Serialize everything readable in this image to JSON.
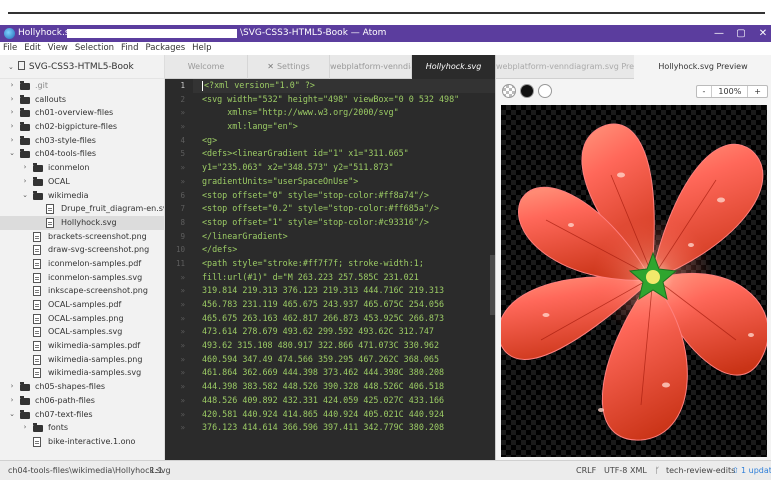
{
  "window": {
    "title_prefix": "Hollyhock.svg —",
    "title_suffix": "\\SVG-CSS3-HTML5-Book — Atom",
    "controls": [
      "—",
      "▢",
      "✕"
    ]
  },
  "menu": [
    "File",
    "Edit",
    "View",
    "Selection",
    "Find",
    "Packages",
    "Help"
  ],
  "tree": {
    "root": "SVG-CSS3-HTML5-Book",
    "items": [
      {
        "label": ".git",
        "type": "folder",
        "level": 1,
        "open": false,
        "muted": true
      },
      {
        "label": "callouts",
        "type": "folder",
        "level": 1,
        "open": false
      },
      {
        "label": "ch01-overview-files",
        "type": "folder",
        "level": 1,
        "open": false
      },
      {
        "label": "ch02-bigpicture-files",
        "type": "folder",
        "level": 1,
        "open": false
      },
      {
        "label": "ch03-style-files",
        "type": "folder",
        "level": 1,
        "open": false
      },
      {
        "label": "ch04-tools-files",
        "type": "folder",
        "level": 1,
        "open": true
      },
      {
        "label": "iconmelon",
        "type": "folder",
        "level": 2,
        "open": false
      },
      {
        "label": "OCAL",
        "type": "folder",
        "level": 2,
        "open": false
      },
      {
        "label": "wikimedia",
        "type": "folder",
        "level": 2,
        "open": true
      },
      {
        "label": "Drupe_fruit_diagram-en.svg",
        "type": "file",
        "level": 3
      },
      {
        "label": "Hollyhock.svg",
        "type": "file",
        "level": 3,
        "selected": true
      },
      {
        "label": "brackets-screenshot.png",
        "type": "file",
        "level": 2
      },
      {
        "label": "draw-svg-screenshot.png",
        "type": "file",
        "level": 2
      },
      {
        "label": "iconmelon-samples.pdf",
        "type": "file",
        "level": 2
      },
      {
        "label": "iconmelon-samples.svg",
        "type": "file",
        "level": 2
      },
      {
        "label": "inkscape-screenshot.png",
        "type": "file",
        "level": 2
      },
      {
        "label": "OCAL-samples.pdf",
        "type": "file",
        "level": 2
      },
      {
        "label": "OCAL-samples.png",
        "type": "file",
        "level": 2
      },
      {
        "label": "OCAL-samples.svg",
        "type": "file",
        "level": 2
      },
      {
        "label": "wikimedia-samples.pdf",
        "type": "file",
        "level": 2
      },
      {
        "label": "wikimedia-samples.png",
        "type": "file",
        "level": 2
      },
      {
        "label": "wikimedia-samples.svg",
        "type": "file",
        "level": 2
      },
      {
        "label": "ch05-shapes-files",
        "type": "folder",
        "level": 1,
        "open": false
      },
      {
        "label": "ch06-path-files",
        "type": "folder",
        "level": 1,
        "open": false
      },
      {
        "label": "ch07-text-files",
        "type": "folder",
        "level": 1,
        "open": true
      },
      {
        "label": "fonts",
        "type": "folder",
        "level": 2,
        "open": false
      },
      {
        "label": "bike-interactive.1.ono",
        "type": "file",
        "level": 2
      }
    ]
  },
  "editor_tabs": [
    {
      "label": "Welcome",
      "active": false
    },
    {
      "label": "Settings",
      "active": false,
      "icon": "wrench-icon"
    },
    {
      "label": "webplatform-venndia",
      "active": false
    },
    {
      "label": "Hollyhock.svg",
      "active": true
    }
  ],
  "code": {
    "current_line": 1,
    "lines": [
      {
        "n": "1",
        "text": "<?xml version=\"1.0\" ?>"
      },
      {
        "n": "2",
        "text": "<svg width=\"532\" height=\"498\" viewBox=\"0 0 532 498\""
      },
      {
        "n": "»",
        "text": "     xmlns=\"http://www.w3.org/2000/svg\""
      },
      {
        "n": "»",
        "text": "     xml:lang=\"en\">"
      },
      {
        "n": "4",
        "text": "<g>"
      },
      {
        "n": "5",
        "text": "<defs><linearGradient id=\"1\" x1=\"311.665\""
      },
      {
        "n": "»",
        "text": "y1=\"235.063\" x2=\"348.573\" y2=\"511.873\""
      },
      {
        "n": "»",
        "text": "gradientUnits=\"userSpaceOnUse\">"
      },
      {
        "n": "6",
        "text": "<stop offset=\"0\" style=\"stop-color:#ff8a74\"/>"
      },
      {
        "n": "7",
        "text": "<stop offset=\"0.2\" style=\"stop-color:#ff685a\"/>"
      },
      {
        "n": "8",
        "text": "<stop offset=\"1\" style=\"stop-color:#c93316\"/>"
      },
      {
        "n": "9",
        "text": "</linearGradient>"
      },
      {
        "n": "10",
        "text": "</defs>"
      },
      {
        "n": "11",
        "text": "<path style=\"stroke:#ff7f7f; stroke-width:1;"
      },
      {
        "n": "»",
        "text": "fill:url(#1)\" d=\"M 263.223 257.585C 231.021"
      },
      {
        "n": "»",
        "text": "319.814 219.313 376.123 219.313 444.716C 219.313"
      },
      {
        "n": "»",
        "text": "456.783 231.119 465.675 243.937 465.675C 254.056"
      },
      {
        "n": "»",
        "text": "465.675 263.163 462.817 266.873 453.925C 266.873"
      },
      {
        "n": "»",
        "text": "473.614 278.679 493.62 299.592 493.62C 312.747"
      },
      {
        "n": "»",
        "text": "493.62 315.108 480.917 322.866 471.073C 330.962"
      },
      {
        "n": "»",
        "text": "460.594 347.49 474.566 359.295 467.262C 368.065"
      },
      {
        "n": "»",
        "text": "461.864 362.669 444.398 373.462 444.398C 380.208"
      },
      {
        "n": "»",
        "text": "444.398 383.582 448.526 390.328 448.526C 406.518"
      },
      {
        "n": "»",
        "text": "448.526 409.892 432.331 424.059 425.027C 433.166"
      },
      {
        "n": "»",
        "text": "420.581 440.924 414.865 440.924 405.021C 440.924"
      },
      {
        "n": "»",
        "text": "376.123 414.614 366.596 397.411 342.779C 380.208"
      }
    ]
  },
  "preview": {
    "tabs": [
      {
        "label": "webplatform-venndiagram.svg Preview",
        "active": false
      },
      {
        "label": "Hollyhock.svg Preview",
        "active": true
      }
    ],
    "zoom": "100%",
    "zoom_out": "-",
    "zoom_in": "+",
    "colors": {
      "petal_light": "#ff8a74",
      "petal_mid": "#ff685a",
      "petal_dark": "#c93316",
      "center": "#2fa52f"
    }
  },
  "status": {
    "path": "ch04-tools-files\\wikimedia\\Hollyhock.svg",
    "cursor": "1:1",
    "line_ending": "CRLF",
    "encoding": "UTF-8",
    "grammar": "XML",
    "branch": "tech-review-edits",
    "updates": "1 update"
  }
}
